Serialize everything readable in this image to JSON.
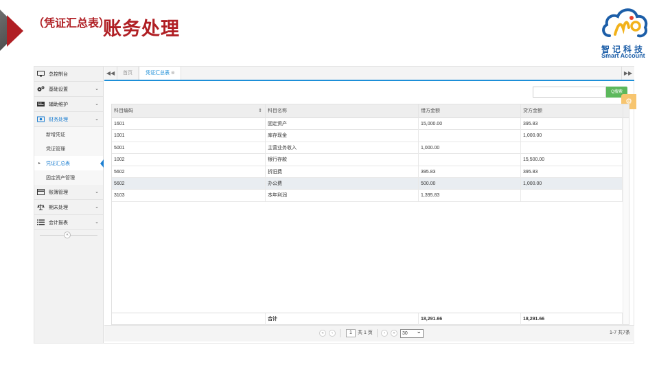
{
  "header": {
    "title": "账务处理",
    "subtitle": "（凭证汇总表）",
    "accent_color": "#b01f24"
  },
  "logo": {
    "cn": "智记科技",
    "en": "Smart Account",
    "brand_color": "#1c5ea8"
  },
  "sidebar": {
    "items": [
      {
        "label": "总控制台",
        "icon": "monitor-icon",
        "has_chevron": false
      },
      {
        "label": "基础设置",
        "icon": "gears-icon",
        "has_chevron": true
      },
      {
        "label": "辅助维护",
        "icon": "keyboard-icon",
        "has_chevron": true
      },
      {
        "label": "财务处理",
        "icon": "money-icon",
        "has_chevron": true,
        "open": true
      }
    ],
    "sub_items": [
      {
        "label": "新增凭证"
      },
      {
        "label": "凭证管理"
      },
      {
        "label": "凭证汇总表",
        "active": true
      },
      {
        "label": "固定资产管理"
      }
    ],
    "items_after": [
      {
        "label": "账簿管理",
        "icon": "ledger-icon"
      },
      {
        "label": "期末处理",
        "icon": "balance-scale-icon"
      },
      {
        "label": "会计报表",
        "icon": "list-icon"
      }
    ],
    "collapse_glyph": "«"
  },
  "tabs": {
    "prev_glyph": "◀◀",
    "next_glyph": "▶▶",
    "items": [
      {
        "label": "首页"
      },
      {
        "label": "凭证汇总表",
        "active": true,
        "close_glyph": "⊗"
      }
    ]
  },
  "search": {
    "value": "",
    "button_label": "Q搜索"
  },
  "table": {
    "columns": [
      "科目编码",
      "科目名称",
      "借方金额",
      "贷方金额"
    ],
    "rows": [
      {
        "code": "1601",
        "name": "固定资产",
        "debit": "15,000.00",
        "credit": "395.83"
      },
      {
        "code": "1001",
        "name": "库存现金",
        "debit": "",
        "credit": "1,000.00"
      },
      {
        "code": "5001",
        "name": "主营业务收入",
        "debit": "1,000.00",
        "credit": ""
      },
      {
        "code": "1002",
        "name": "银行存款",
        "debit": "",
        "credit": "15,500.00"
      },
      {
        "code": "5602",
        "name": "折旧费",
        "debit": "395.83",
        "credit": "395.83"
      },
      {
        "code": "5602",
        "name": "办公费",
        "debit": "500.00",
        "credit": "1,000.00",
        "highlighted": true
      },
      {
        "code": "3103",
        "name": "本年利润",
        "debit": "1,395.83",
        "credit": ""
      }
    ],
    "footer": {
      "label": "合计",
      "debit_total": "18,291.66",
      "credit_total": "18,291.66"
    }
  },
  "pager": {
    "page": "1",
    "total_pages_text": "共 1 页",
    "page_size": "30",
    "count_text": "1-7 共7条"
  }
}
